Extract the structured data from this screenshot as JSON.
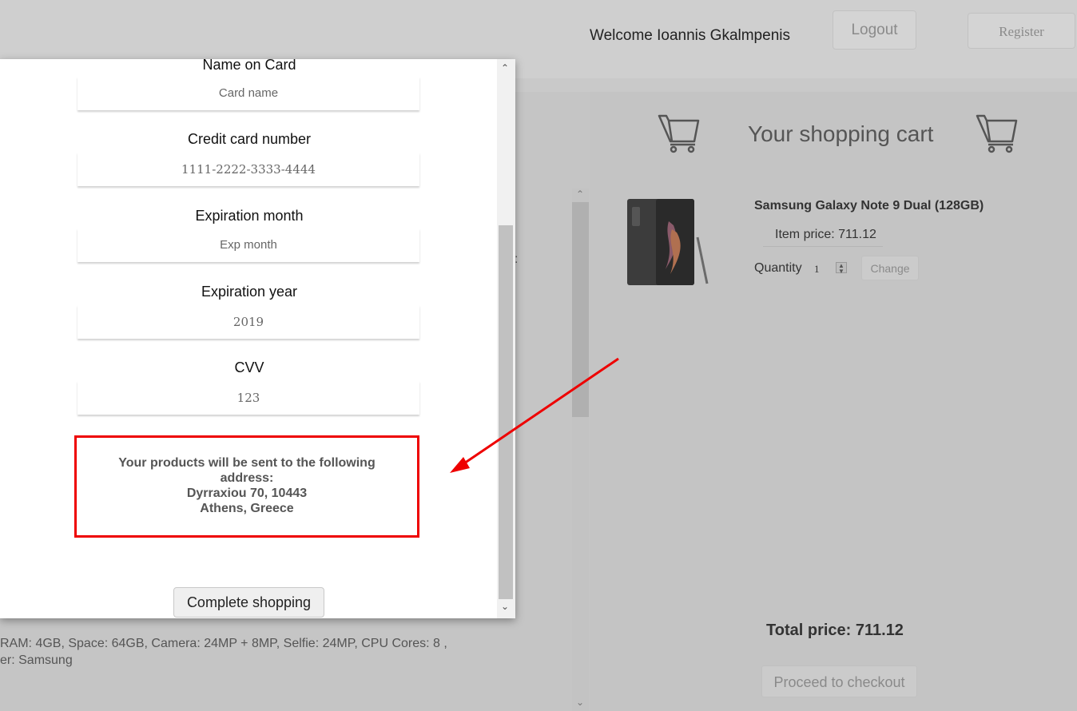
{
  "header": {
    "welcome": "Welcome Ioannis Gkalmpenis",
    "logout_label": "Logout",
    "register_label": "Register"
  },
  "background_page": {
    "spec_line_1": "RAM: 4GB, Space: 64GB, Camera: 24MP + 8MP, Selfie: 24MP, CPU Cores: 8 ,",
    "spec_line_2": "er: Samsung",
    "stray_char": ":"
  },
  "cart": {
    "title": "Your shopping cart",
    "product_name": "Samsung Galaxy Note 9 Dual (128GB)",
    "item_price": "Item price: 711.12",
    "quantity_label": "Quantity",
    "quantity_value": "1",
    "change_label": "Change",
    "total": "Total price: 711.12",
    "checkout_label": "Proceed to checkout"
  },
  "modal": {
    "fields": [
      {
        "label": "Name on Card",
        "placeholder": "Card name"
      },
      {
        "label": "Credit card number",
        "placeholder": "1111-2222-3333-4444"
      },
      {
        "label": "Expiration month",
        "placeholder": "Exp month"
      },
      {
        "label": "Expiration year",
        "placeholder": "2019"
      },
      {
        "label": "CVV",
        "placeholder": "123"
      }
    ],
    "address_line_1": "Your products will be sent to the following",
    "address_line_2": "address:",
    "address_line_3": "Dyrraxiou 70, 10443",
    "address_line_4": "Athens, Greece",
    "complete_label": "Complete shopping"
  },
  "colors": {
    "annotation": "#ee0000",
    "overlay": "#c9c9c9"
  }
}
